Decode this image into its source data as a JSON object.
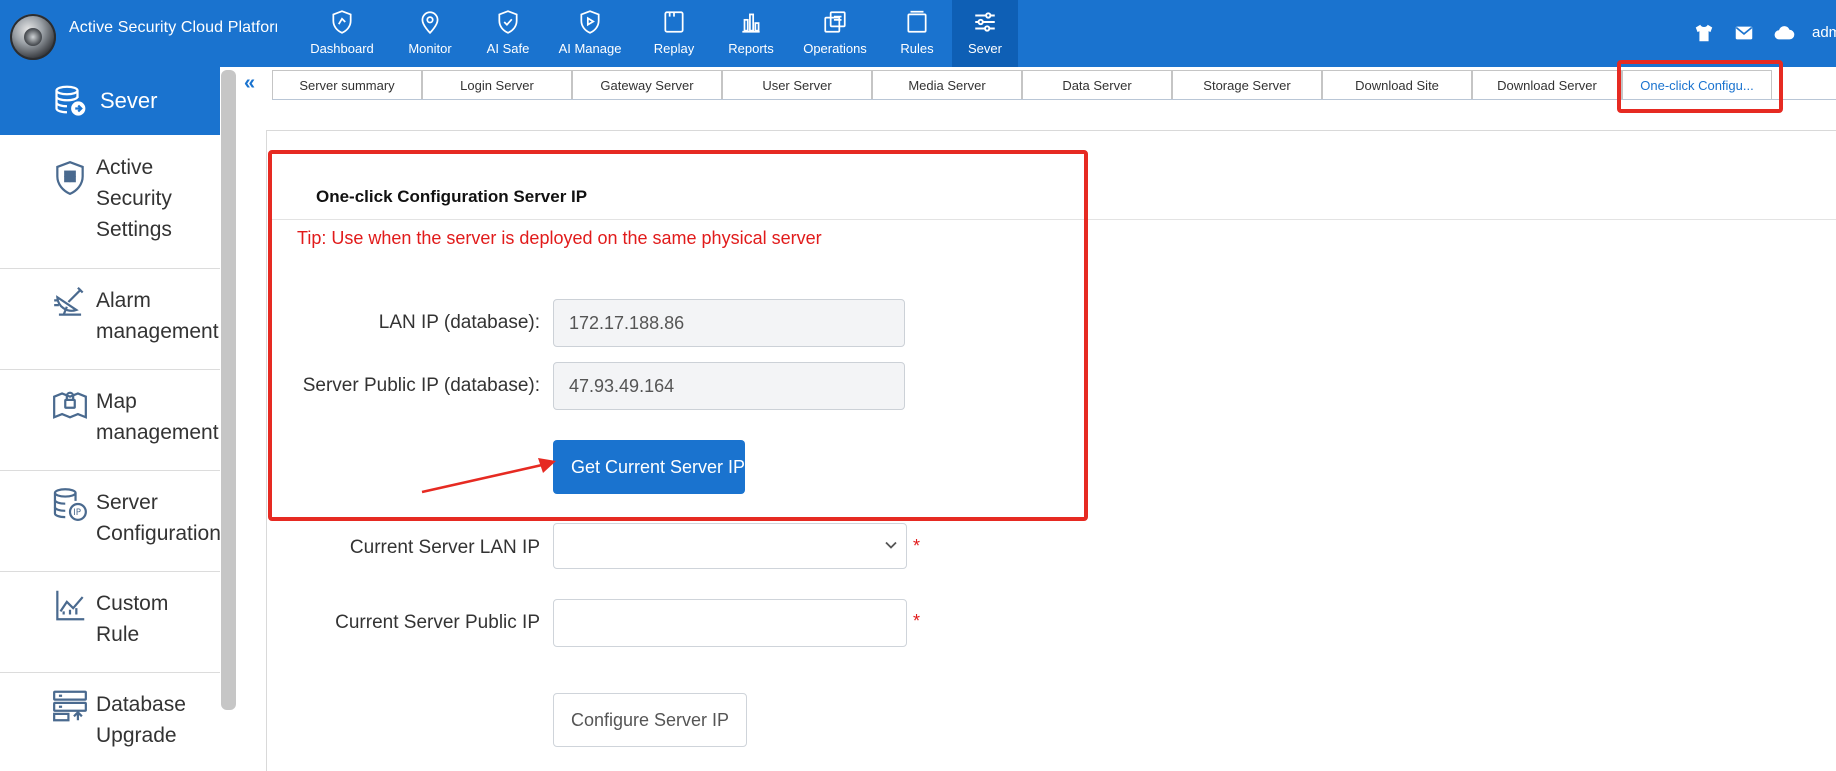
{
  "app": {
    "title": "Active Security Cloud Platform",
    "user": "admin"
  },
  "nav": [
    {
      "label": "Dashboard",
      "icon": "dashboard-shield-icon"
    },
    {
      "label": "Monitor",
      "icon": "map-pin-icon"
    },
    {
      "label": "AI Safe",
      "icon": "shield-check-icon"
    },
    {
      "label": "AI Manage",
      "icon": "shield-play-icon"
    },
    {
      "label": "Replay",
      "icon": "replay-icon"
    },
    {
      "label": "Reports",
      "icon": "bar-chart-icon"
    },
    {
      "label": "Operations",
      "icon": "operations-icon"
    },
    {
      "label": "Rules",
      "icon": "rules-icon"
    },
    {
      "label": "Sever",
      "icon": "sliders-icon",
      "active": true
    }
  ],
  "top_icons": [
    "shirt-icon",
    "mail-icon",
    "cloud-icon"
  ],
  "sidebar": {
    "header": "Sever",
    "items": [
      {
        "label": "Active\nSecurity\nSettings",
        "icon": "shield-grid-icon"
      },
      {
        "label": "Alarm\nmanagement",
        "icon": "radar-dish-icon"
      },
      {
        "label": "Map\nmanagement",
        "icon": "map-lock-icon"
      },
      {
        "label": "Server\nConfiguration",
        "icon": "database-ip-icon"
      },
      {
        "label": "Custom\nRule",
        "icon": "line-chart-icon"
      },
      {
        "label": "Database\nUpgrade",
        "icon": "database-upgrade-icon"
      }
    ]
  },
  "tabs": [
    "Server summary",
    "Login Server",
    "Gateway Server",
    "User Server",
    "Media Server",
    "Data Server",
    "Storage Server",
    "Download Site",
    "Download Server",
    "One-click Configu..."
  ],
  "active_tab": "One-click Configu...",
  "form": {
    "title": "One-click Configuration Server IP",
    "tip": "Tip: Use when the server is deployed on the same physical server",
    "lan_ip_label": "LAN IP (database):",
    "lan_ip_value": "172.17.188.86",
    "public_ip_label": "Server Public IP (database):",
    "public_ip_value": "47.93.49.164",
    "get_ip_button": "Get Current Server IP",
    "current_lan_label": "Current Server LAN IP",
    "current_public_label": "Current Server Public IP",
    "required_mark": "*",
    "configure_button": "Configure Server IP"
  },
  "colors": {
    "primary": "#1a73cf",
    "annotation_red": "#e62a22",
    "tip_red": "#e11b1b"
  }
}
